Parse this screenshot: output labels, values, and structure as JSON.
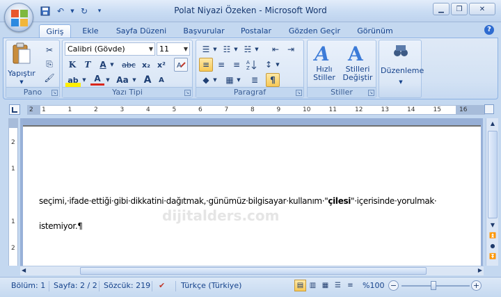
{
  "window": {
    "title": "Polat Niyazi Özeken - Microsoft Word",
    "minimize_icon": "minimize-icon",
    "restore_icon": "restore-icon",
    "close_icon": "close-icon"
  },
  "qat": {
    "save_icon": "save-icon",
    "undo_icon": "undo-icon",
    "redo_icon": "redo-icon",
    "customize_icon": "customize-qat-icon"
  },
  "tabs": [
    {
      "label": "Giriş",
      "active": true
    },
    {
      "label": "Ekle"
    },
    {
      "label": "Sayfa Düzeni"
    },
    {
      "label": "Başvurular"
    },
    {
      "label": "Postalar"
    },
    {
      "label": "Gözden Geçir"
    },
    {
      "label": "Görünüm"
    }
  ],
  "ribbon": {
    "pano": {
      "label": "Pano",
      "paste_label": "Yapıştır"
    },
    "font": {
      "label": "Yazı Tipi",
      "font_name": "Calibri (Gövde)",
      "font_size": "11",
      "bold": "K",
      "italic": "T",
      "underline": "A",
      "strike": "abc",
      "subscript": "x₂",
      "superscript": "x²",
      "highlight": "ab",
      "font_color": "A",
      "change_case": "Aa",
      "grow": "A",
      "shrink": "A"
    },
    "paragraph": {
      "label": "Paragraf",
      "show_marks": "¶"
    },
    "styles": {
      "label": "Stiller",
      "quick_styles": "Hızlı Stiller",
      "change_styles": "Stilleri Değiştir"
    },
    "editing": {
      "label": "Düzenleme"
    }
  },
  "ruler": {
    "numbers": [
      "2",
      "1",
      "1",
      "2",
      "3",
      "4",
      "5",
      "6",
      "7",
      "8",
      "9",
      "10",
      "11",
      "12",
      "13",
      "14",
      "15",
      "16"
    ],
    "vertical_numbers": [
      "2",
      "1",
      "1",
      "2"
    ]
  },
  "document": {
    "line1_a": "seçimi,·ifade·ettiği·gibi·dikkatini·dağıtmak,·günümüz·bilgisayar·kullanım·\"",
    "line1_bold": "çilesi",
    "line1_b": "\"·içerisinde·yorulmak·",
    "line2": "istemiyor.¶",
    "watermark": "dijitalders.com"
  },
  "status": {
    "section": "Bölüm: 1",
    "page": "Sayfa: 2 / 2",
    "words": "Sözcük: 219",
    "language": "Türkçe (Türkiye)",
    "zoom": "%100",
    "zoom_out": "−",
    "zoom_in": "+",
    "zoom_level": 0.5
  },
  "colors": {
    "accent": "#15428b",
    "selected": "#f8c955"
  }
}
